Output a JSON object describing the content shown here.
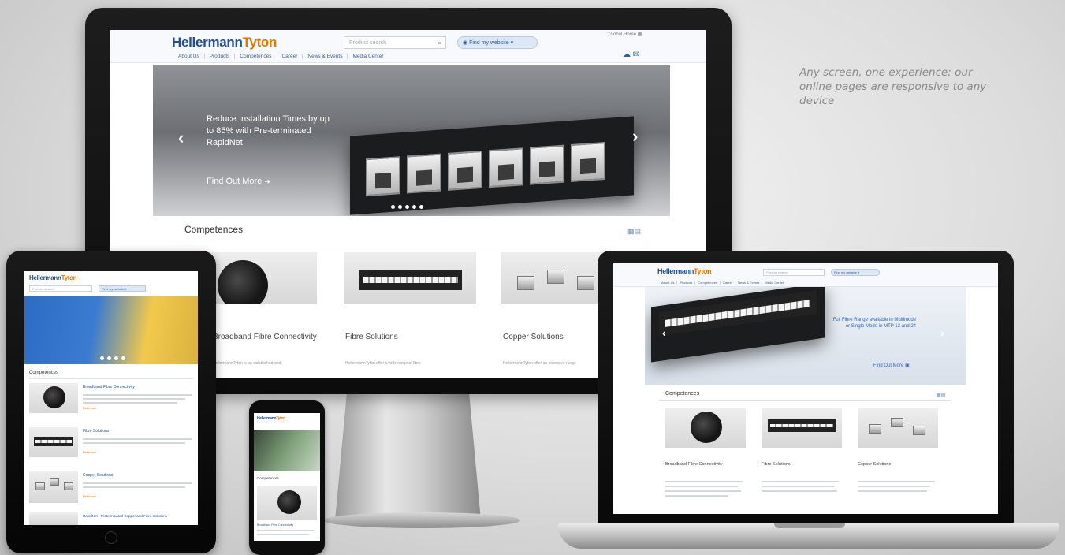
{
  "tagline": "Any screen, one experience: our online pages are responsive to any device",
  "site": {
    "logo_part1": "Hellermann",
    "logo_part2": "Tyton",
    "search_placeholder": "Product search",
    "world_button": "Find my website ▾",
    "top_link": "Global Home ▦",
    "nav": [
      "About Us",
      "Products",
      "Competences",
      "Career",
      "News & Events",
      "Media Center"
    ],
    "header_icons": "☁ ✉"
  },
  "desktop": {
    "hero_text": "Reduce Installation Times by up to 85% with Pre-terminated RapidNet",
    "hero_cta": "Find Out More",
    "competences_title": "Competences",
    "products": [
      {
        "name": "Broadband Fibre Connectivity",
        "desc": "HellermannTyton is an established and"
      },
      {
        "name": "Fibre Solutions",
        "desc": "HellermannTyton offer a wide range of fibre"
      },
      {
        "name": "Copper Solutions",
        "desc": "HellermannTyton offer an extensive range"
      }
    ]
  },
  "tablet": {
    "products": [
      "Broadband Fibre Connectivity",
      "Fibre Solutions",
      "Copper Solutions",
      "RapidNet - Preterminated Copper and Fibre Solutions"
    ],
    "read_more": "Read more"
  },
  "phone": {
    "competences_title": "Competences",
    "product": "Broadband Fibre Connectivity"
  },
  "laptop": {
    "hero_text": "Full Fibre Range available in Multimode or Single Mode in MTP 12 and 24",
    "hero_cta": "Find Out More",
    "competences_title": "Competences",
    "products": [
      "Broadband Fibre Connectivity",
      "Fibre Solutions",
      "Copper Solutions"
    ]
  },
  "colors": {
    "brand_blue": "#1f4e9a",
    "brand_orange": "#e27800"
  }
}
